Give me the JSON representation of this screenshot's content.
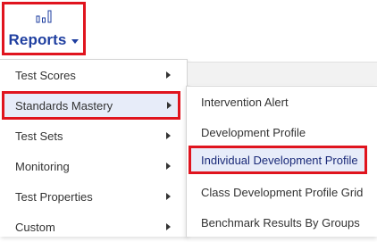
{
  "toolbar": {
    "reports_label": "Reports",
    "reports_icon": "bar-chart-icon",
    "caret_icon": "caret-down-icon"
  },
  "menu": {
    "items": [
      {
        "label": "Test Scores"
      },
      {
        "label": "Standards Mastery",
        "highlighted": true
      },
      {
        "label": "Test Sets"
      },
      {
        "label": "Monitoring"
      },
      {
        "label": "Test Properties"
      },
      {
        "label": "Custom"
      }
    ],
    "submenu_arrow_icon": "chevron-right-icon"
  },
  "submenu": {
    "items": [
      {
        "label": "Intervention Alert"
      },
      {
        "label": "Development Profile"
      },
      {
        "label": "Individual Development Profile",
        "highlighted": true
      },
      {
        "label": "Class Development Profile Grid"
      },
      {
        "label": "Benchmark Results By Groups"
      }
    ]
  },
  "colors": {
    "accent": "#1f3fa0",
    "highlight_border": "#e0141e",
    "highlight_bg": "#e7ecf9"
  }
}
